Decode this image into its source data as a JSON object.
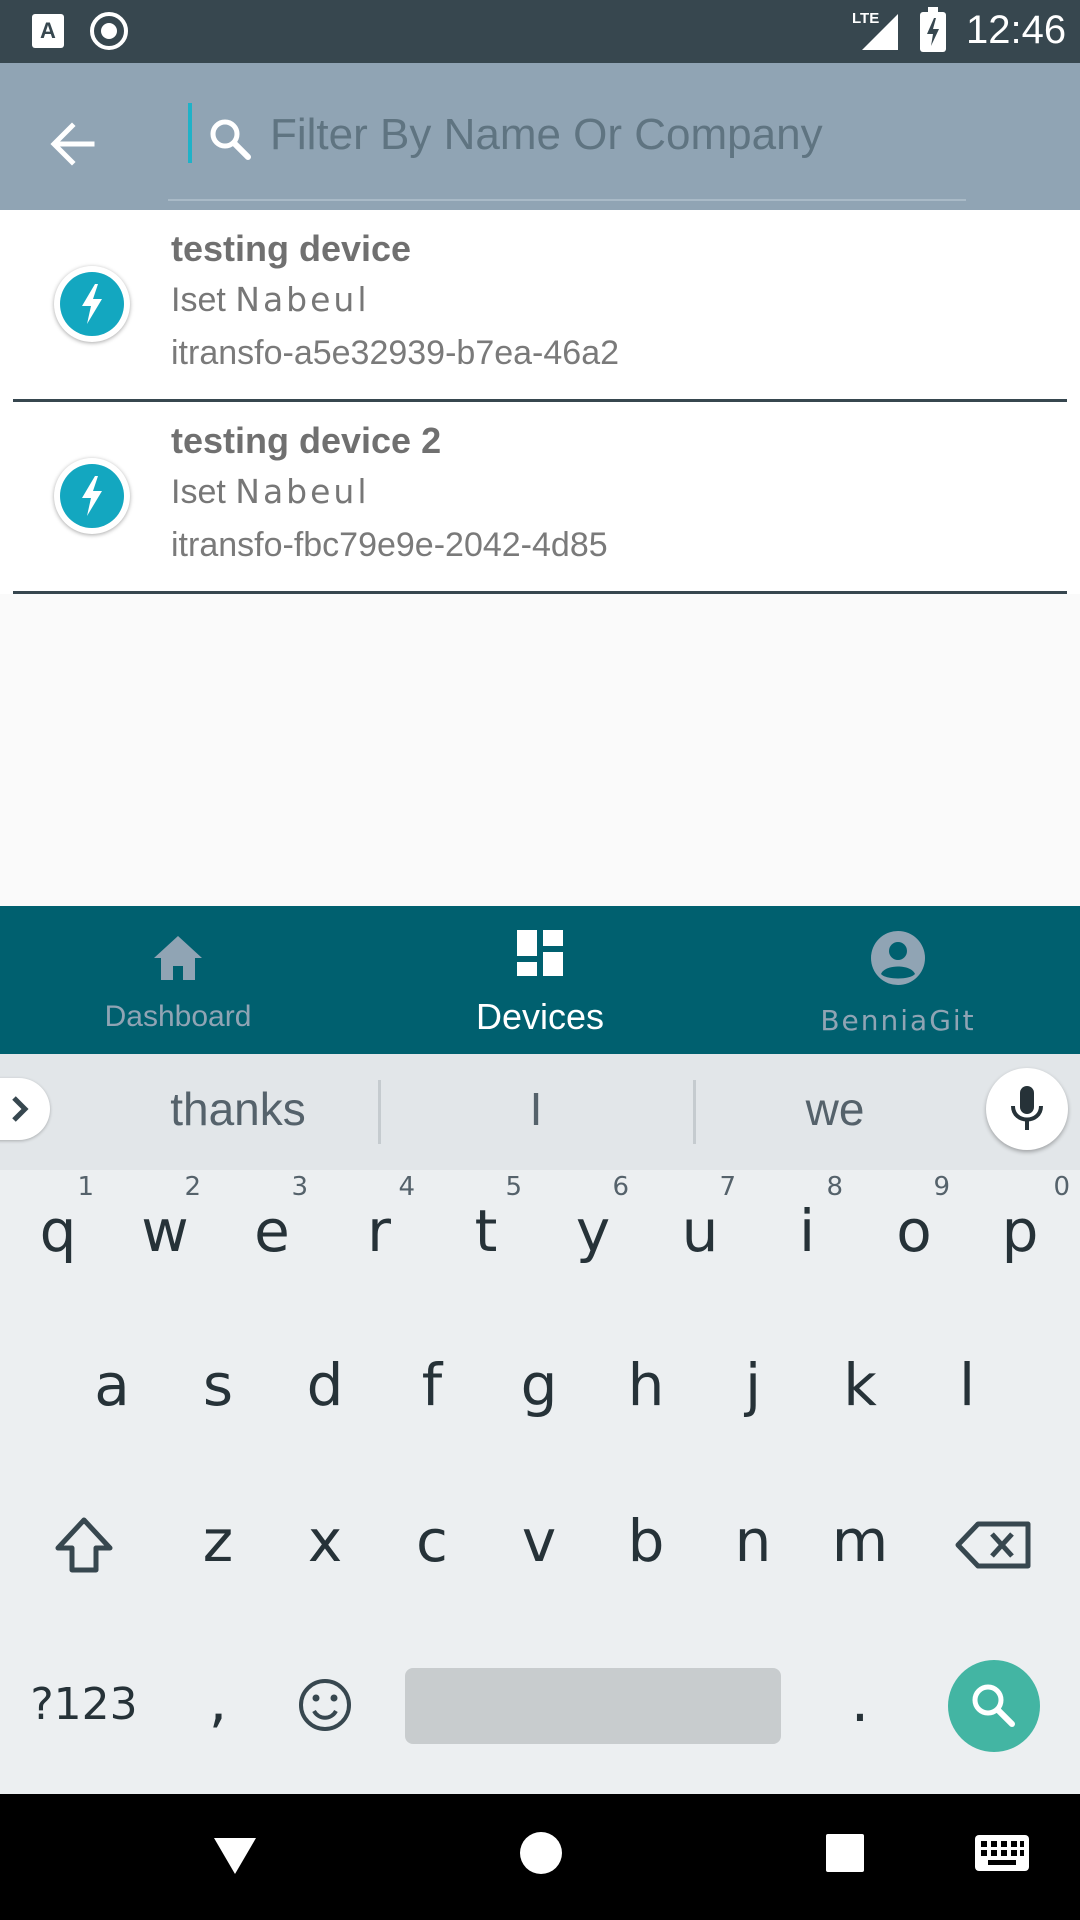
{
  "status_bar": {
    "time": "12:46",
    "network": "LTE"
  },
  "toolbar": {
    "search_placeholder": "Filter By Name Or Company"
  },
  "devices": [
    {
      "name": "testing device",
      "company": "Iset",
      "city": "Nabeul",
      "id": "itransfo-a5e32939-b7ea-46a2"
    },
    {
      "name": "testing device 2",
      "company": "Iset",
      "city": "Nabeul",
      "id": "itransfo-fbc79e9e-2042-4d85"
    }
  ],
  "bottom_nav": {
    "dashboard": "Dashboard",
    "devices": "Devices",
    "profile": "BenniaGit"
  },
  "suggestions": [
    "thanks",
    "I",
    "we"
  ],
  "keyboard": {
    "row1": [
      "q",
      "w",
      "e",
      "r",
      "t",
      "y",
      "u",
      "i",
      "o",
      "p"
    ],
    "row1_hints": [
      "1",
      "2",
      "3",
      "4",
      "5",
      "6",
      "7",
      "8",
      "9",
      "0"
    ],
    "row2": [
      "a",
      "s",
      "d",
      "f",
      "g",
      "h",
      "j",
      "k",
      "l"
    ],
    "row3": [
      "z",
      "x",
      "c",
      "v",
      "b",
      "n",
      "m"
    ],
    "symbols": "?123",
    "comma": ",",
    "period": "."
  },
  "colors": {
    "status_bar": "#37474f",
    "toolbar": "#90a4b4",
    "accent": "#13a7c0",
    "bottom_nav": "#00606f",
    "search_key": "#43b5a3"
  }
}
